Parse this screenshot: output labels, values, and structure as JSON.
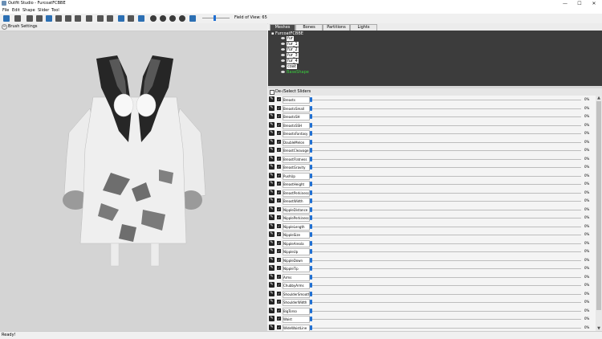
{
  "window": {
    "title": "Outfit Studio - FurcoatFCBBE",
    "minimize": "—",
    "maximize": "☐",
    "close": "✕"
  },
  "menu": [
    "File",
    "Edit",
    "Shape",
    "Slider",
    "Tool"
  ],
  "toolbar": {
    "field_of_view_label": "Field of View: 65"
  },
  "viewport": {
    "brush_settings_label": "Brush Settings",
    "toggle_glyph": "−"
  },
  "tabs": [
    "Meshes",
    "Bones",
    "Partitions",
    "Lights"
  ],
  "tree": {
    "root": "FurcoatFCBBE",
    "meshes": [
      "fur",
      "fur_1",
      "fur_2",
      "fur_3",
      "fur_4",
      "coat"
    ],
    "reference": "BaseShape"
  },
  "sliders_header": "De-/Select Sliders",
  "sliders": [
    {
      "name": "Breasts",
      "value": "0%"
    },
    {
      "name": "BreastsSmall",
      "value": "0%"
    },
    {
      "name": "BreastsSH",
      "value": "0%"
    },
    {
      "name": "BreastsSSH",
      "value": "0%"
    },
    {
      "name": "BreastsFantasy",
      "value": "0%"
    },
    {
      "name": "DoubleMelon",
      "value": "0%"
    },
    {
      "name": "BreastCleavage",
      "value": "0%"
    },
    {
      "name": "BreastFlatness",
      "value": "0%"
    },
    {
      "name": "BreastGravity",
      "value": "0%"
    },
    {
      "name": "PushUp",
      "value": "0%"
    },
    {
      "name": "BreastHeight",
      "value": "0%"
    },
    {
      "name": "BreastPerkiness",
      "value": "0%"
    },
    {
      "name": "BreastWidth",
      "value": "0%"
    },
    {
      "name": "NippleDistance",
      "value": "0%"
    },
    {
      "name": "NipplePerkiness",
      "value": "0%"
    },
    {
      "name": "NippleLength",
      "value": "0%"
    },
    {
      "name": "NippleSize",
      "value": "0%"
    },
    {
      "name": "NippleAreola",
      "value": "0%"
    },
    {
      "name": "NippleUp",
      "value": "0%"
    },
    {
      "name": "NippleDown",
      "value": "0%"
    },
    {
      "name": "NippleTip",
      "value": "0%"
    },
    {
      "name": "Arms",
      "value": "0%"
    },
    {
      "name": "ChubbyArms",
      "value": "0%"
    },
    {
      "name": "ShoulderSmooth",
      "value": "0%"
    },
    {
      "name": "ShoulderWidth",
      "value": "0%"
    },
    {
      "name": "BigTorso",
      "value": "0%"
    },
    {
      "name": "Waist",
      "value": "0%"
    },
    {
      "name": "WideWaistLine",
      "value": "0%"
    }
  ],
  "status": "Ready!"
}
